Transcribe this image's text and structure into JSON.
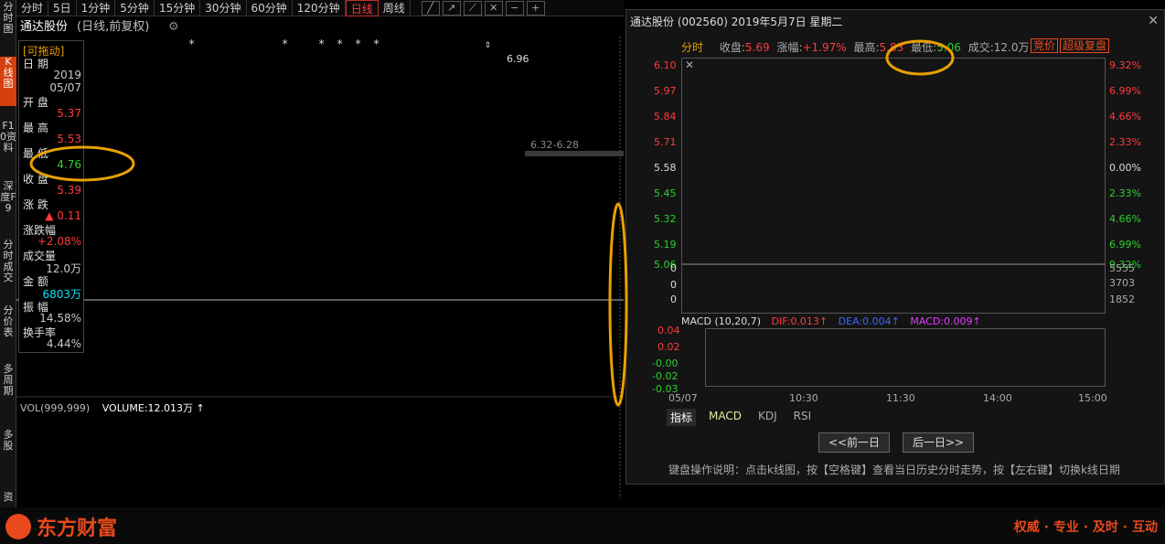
{
  "sidebar": {
    "items": [
      "分时图",
      "K线图",
      "F10资料",
      "深度F9",
      "分时成交",
      "分价表",
      "多周期",
      "多股",
      "资"
    ]
  },
  "periods": [
    "分时",
    "5日",
    "1分钟",
    "5分钟",
    "15分钟",
    "30分钟",
    "60分钟",
    "120分钟",
    "日线",
    "周线"
  ],
  "stock": {
    "name": "通达股份",
    "sub": "(日线,前复权)"
  },
  "info": {
    "drag_label": "[可拖动]",
    "date_label": "日 期",
    "date_line1": "2019",
    "date_line2": "05/07",
    "open_label": "开 盘",
    "open": "5.37",
    "high_label": "最 高",
    "high": "5.53",
    "low_label": "最 低",
    "low": "4.76",
    "close_label": "收 盘",
    "close": "5.39",
    "change_label": "涨 跌",
    "change": "▲ 0.11",
    "pct_label": "涨跌幅",
    "pct": "+2.08%",
    "vol_label": "成交量",
    "vol": "12.0万",
    "amt_label": "金 额",
    "amt": "6803万",
    "amp_label": "振 幅",
    "amp": "14.58%",
    "turn_label": "换手率",
    "turn": "4.44%"
  },
  "annotations": {
    "peak": "6.96",
    "level": "6.32-6.28"
  },
  "volume": {
    "header": "VOL(999,999)",
    "value": "VOLUME:12.013万 ↑"
  },
  "brand": {
    "logo": "东方财富",
    "slogan": "权威 · 专业 · 及时 · 互动"
  },
  "popup": {
    "title": "通达股份 (002560)  2019年5月7日 星期二",
    "mode": "分时",
    "close_label": "收盘:",
    "close": "5.69",
    "pct_label": "涨幅:",
    "pct": "+1.97%",
    "high_label": "最高:",
    "high": "5.83",
    "low_label": "最低:",
    "low": "5.06",
    "vol_label": "成交:",
    "vol": "12.0万",
    "btn1": "竞价",
    "btn2": "超级复盘",
    "y_left": [
      "6.10",
      "5.97",
      "5.84",
      "5.71",
      "5.58",
      "5.45",
      "5.32",
      "5.19",
      "5.06"
    ],
    "y_right": [
      "9.32%",
      "6.99%",
      "4.66%",
      "2.33%",
      "0.00%",
      "2.33%",
      "4.66%",
      "6.99%",
      "9.32%"
    ],
    "vol_right": [
      "5555",
      "3703",
      "1852"
    ],
    "vol_left": [
      "0",
      "0",
      "0"
    ],
    "macd_header": "MACD (10,20,7)",
    "dif": "DIF:0.013↑",
    "dea": "DEA:0.004↑",
    "macd": "MACD:0.009↑",
    "macd_axis": [
      "0.04",
      "0.02",
      "-0.00",
      "-0.02",
      "-0.03"
    ],
    "x_axis": [
      "05/07",
      "10:30",
      "11:30",
      "14:00",
      "15:00"
    ],
    "tabs": [
      "指标",
      "MACD",
      "KDJ",
      "RSI"
    ],
    "prev": "<<前一日",
    "next": "后一日>>",
    "help": "键盘操作说明：点击k线图，按【空格键】查看当日历史分时走势，按【左右键】切换k线日期"
  },
  "colors": {
    "rise": "#ff3b3b",
    "fall": "#00e5ff",
    "highlight": "#e8a000",
    "brand": "#e8491d"
  }
}
